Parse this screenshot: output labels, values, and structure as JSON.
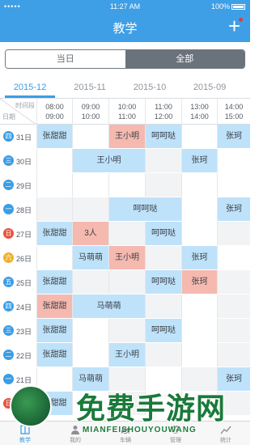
{
  "status_bar": {
    "carrier": "•••••",
    "time": "11:27 AM",
    "battery": "100%"
  },
  "navbar": {
    "title": "教学",
    "add_icon": "plus-icon",
    "add_label": "+"
  },
  "segment": {
    "today": "当日",
    "all": "全部",
    "selected": "全部"
  },
  "months": [
    "2015-12",
    "2015-11",
    "2015-10",
    "2015-09"
  ],
  "active_month": "2015-12",
  "header": {
    "corner_top": "时间段",
    "corner_bottom": "日期"
  },
  "time_slots": [
    {
      "start": "08:00",
      "end": "09:00"
    },
    {
      "start": "09:00",
      "end": "10:00"
    },
    {
      "start": "10:00",
      "end": "11:00"
    },
    {
      "start": "11:00",
      "end": "12:00"
    },
    {
      "start": "13:00",
      "end": "14:00"
    },
    {
      "start": "14:00",
      "end": "15:00"
    }
  ],
  "weekday_colors": {
    "一": "#3a9de6",
    "二": "#3a9de6",
    "三": "#3a9de6",
    "四": "#3a9de6",
    "五": "#3a9de6",
    "六": "#f0b128",
    "日": "#e8513e"
  },
  "rows": [
    {
      "weekday": "四",
      "day": "31日",
      "cells": [
        {
          "text": "张甜甜",
          "type": "blue"
        },
        {
          "text": "",
          "type": "empty"
        },
        {
          "text": "王小明",
          "type": "red"
        },
        {
          "text": "呵呵哒",
          "type": "blue"
        },
        {
          "text": "",
          "type": "empty"
        },
        {
          "text": "张珂",
          "type": "blue"
        }
      ]
    },
    {
      "weekday": "三",
      "day": "30日",
      "cells": [
        {
          "text": "",
          "type": "empty"
        },
        {
          "text": "王小明",
          "type": "blue",
          "span": 2
        },
        {
          "text": "",
          "type": "grey"
        },
        {
          "text": "张珂",
          "type": "blue"
        },
        {
          "text": "",
          "type": "empty"
        }
      ]
    },
    {
      "weekday": "二",
      "day": "29日",
      "cells": [
        {
          "text": "",
          "type": "empty"
        },
        {
          "text": "",
          "type": "empty"
        },
        {
          "text": "",
          "type": "empty"
        },
        {
          "text": "",
          "type": "grey"
        },
        {
          "text": "",
          "type": "empty"
        },
        {
          "text": "",
          "type": "empty"
        }
      ]
    },
    {
      "weekday": "一",
      "day": "28日",
      "cells": [
        {
          "text": "",
          "type": "grey"
        },
        {
          "text": "",
          "type": "grey"
        },
        {
          "text": "呵呵哒",
          "type": "blue",
          "span": 2
        },
        {
          "text": "",
          "type": "empty"
        },
        {
          "text": "张珂",
          "type": "blue"
        }
      ]
    },
    {
      "weekday": "日",
      "day": "27日",
      "cells": [
        {
          "text": "张甜甜",
          "type": "blue"
        },
        {
          "text": "3人",
          "type": "red"
        },
        {
          "text": "",
          "type": "grey"
        },
        {
          "text": "呵呵哒",
          "type": "blue"
        },
        {
          "text": "",
          "type": "empty"
        },
        {
          "text": "",
          "type": "grey"
        }
      ]
    },
    {
      "weekday": "六",
      "day": "26日",
      "cells": [
        {
          "text": "",
          "type": "empty"
        },
        {
          "text": "马萌萌",
          "type": "blue"
        },
        {
          "text": "王小明",
          "type": "red"
        },
        {
          "text": "",
          "type": "grey"
        },
        {
          "text": "张珂",
          "type": "blue"
        },
        {
          "text": "",
          "type": "empty"
        }
      ]
    },
    {
      "weekday": "五",
      "day": "25日",
      "cells": [
        {
          "text": "张甜甜",
          "type": "blue"
        },
        {
          "text": "",
          "type": "grey"
        },
        {
          "text": "",
          "type": "grey"
        },
        {
          "text": "呵呵哒",
          "type": "blue"
        },
        {
          "text": "张珂",
          "type": "red"
        },
        {
          "text": "",
          "type": "grey"
        }
      ]
    },
    {
      "weekday": "四",
      "day": "24日",
      "cells": [
        {
          "text": "张甜甜",
          "type": "red"
        },
        {
          "text": "马萌萌",
          "type": "blue",
          "span": 2
        },
        {
          "text": "",
          "type": "grey"
        },
        {
          "text": "",
          "type": "empty"
        },
        {
          "text": "",
          "type": "grey"
        }
      ]
    },
    {
      "weekday": "三",
      "day": "23日",
      "cells": [
        {
          "text": "张甜甜",
          "type": "blue"
        },
        {
          "text": "",
          "type": "empty"
        },
        {
          "text": "",
          "type": "grey"
        },
        {
          "text": "呵呵哒",
          "type": "blue"
        },
        {
          "text": "",
          "type": "empty"
        },
        {
          "text": "",
          "type": "grey"
        }
      ]
    },
    {
      "weekday": "二",
      "day": "22日",
      "cells": [
        {
          "text": "张甜甜",
          "type": "blue"
        },
        {
          "text": "",
          "type": "empty"
        },
        {
          "text": "王小明",
          "type": "blue"
        },
        {
          "text": "",
          "type": "grey"
        },
        {
          "text": "",
          "type": "empty"
        },
        {
          "text": "",
          "type": "grey"
        }
      ]
    },
    {
      "weekday": "一",
      "day": "21日",
      "cells": [
        {
          "text": "",
          "type": "empty"
        },
        {
          "text": "马萌萌",
          "type": "blue"
        },
        {
          "text": "",
          "type": "grey"
        },
        {
          "text": "",
          "type": "empty"
        },
        {
          "text": "",
          "type": "grey"
        },
        {
          "text": "张珂",
          "type": "blue"
        }
      ]
    },
    {
      "weekday": "日",
      "day": "20日",
      "cells": [
        {
          "text": "张甜甜",
          "type": "blue"
        },
        {
          "text": "",
          "type": "empty"
        },
        {
          "text": "",
          "type": "grey"
        },
        {
          "text": "",
          "type": "empty"
        },
        {
          "text": "",
          "type": "empty"
        },
        {
          "text": "",
          "type": "grey"
        }
      ]
    }
  ],
  "tabbar": [
    {
      "label": "教学",
      "icon": "book-icon",
      "active": true
    },
    {
      "label": "我的",
      "icon": "person-icon",
      "active": false
    },
    {
      "label": "车辆",
      "icon": "car-icon",
      "active": false
    },
    {
      "label": "管理",
      "icon": "gear-icon",
      "active": false
    },
    {
      "label": "统计",
      "icon": "chart-icon",
      "active": false
    }
  ],
  "watermark": {
    "title": "免费手游网",
    "subtitle": "MIANFEISHOUYOUWANG"
  }
}
